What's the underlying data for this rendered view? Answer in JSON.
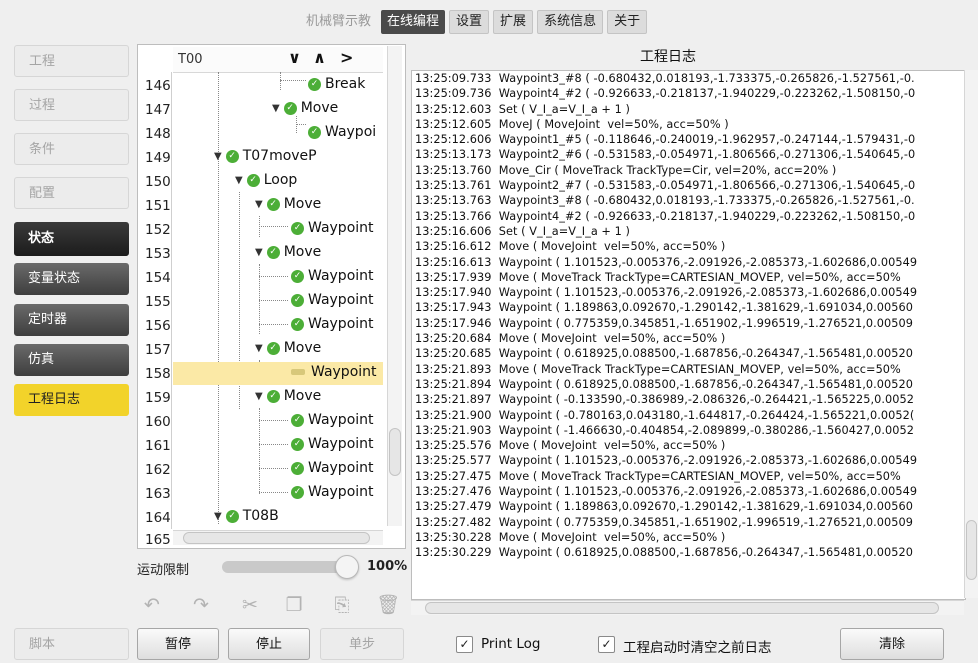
{
  "top_tabs": [
    {
      "label": "机械臂示教",
      "state": "disabled"
    },
    {
      "label": "在线编程",
      "state": "active"
    },
    {
      "label": "设置",
      "state": "normal"
    },
    {
      "label": "扩展",
      "state": "normal"
    },
    {
      "label": "系统信息",
      "state": "normal"
    },
    {
      "label": "关于",
      "state": "normal"
    }
  ],
  "sidebar": {
    "items": [
      {
        "label": "工程",
        "state": "disabled"
      },
      {
        "label": "过程",
        "state": "disabled"
      },
      {
        "label": "条件",
        "state": "disabled"
      },
      {
        "label": "配置",
        "state": "disabled"
      },
      {
        "label": "状态",
        "state": "header"
      },
      {
        "label": "变量状态",
        "state": "dark"
      },
      {
        "label": "定时器",
        "state": "dark"
      },
      {
        "label": "仿真",
        "state": "dark"
      },
      {
        "label": "工程日志",
        "state": "selected"
      }
    ],
    "script_label": "脚本"
  },
  "tree": {
    "header_label": "T00",
    "nav": {
      "down": "⌄",
      "up": "⌃",
      "right": "›"
    },
    "line_numbers": [
      "146",
      "147",
      "148",
      "149",
      "150",
      "151",
      "152",
      "153",
      "154",
      "155",
      "156",
      "157",
      "158",
      "159",
      "160",
      "161",
      "162",
      "163",
      "164",
      "165"
    ],
    "nodes": [
      {
        "label": "Break",
        "expanded": false
      },
      {
        "label": "Move",
        "expanded": true
      },
      {
        "label": "Waypoi",
        "expanded": false
      },
      {
        "label": "T07moveP",
        "expanded": true
      },
      {
        "label": "Loop",
        "expanded": true
      },
      {
        "label": "Move",
        "expanded": true
      },
      {
        "label": "Waypoint",
        "expanded": false
      },
      {
        "label": "Move",
        "expanded": true
      },
      {
        "label": "Waypoint",
        "expanded": false
      },
      {
        "label": "Waypoint",
        "expanded": false
      },
      {
        "label": "Waypoint",
        "expanded": false
      },
      {
        "label": "Move",
        "expanded": true
      },
      {
        "label": "Waypoint",
        "expanded": false,
        "selected": true
      },
      {
        "label": "Move",
        "expanded": true
      },
      {
        "label": "Waypoint",
        "expanded": false
      },
      {
        "label": "Waypoint",
        "expanded": false
      },
      {
        "label": "Waypoint",
        "expanded": false
      },
      {
        "label": "Waypoint",
        "expanded": false
      },
      {
        "label": "T08B",
        "expanded": true
      }
    ]
  },
  "speed_limit": {
    "label": "运动限制",
    "value_text": "100%",
    "value": 1.0
  },
  "toolbar_icons": [
    "undo-icon",
    "redo-icon",
    "cut-icon",
    "copy-icon",
    "paste-icon",
    "delete-icon"
  ],
  "bottom_buttons": {
    "pause": "暂停",
    "stop": "停止",
    "step": "单步"
  },
  "log": {
    "title": "工程日志",
    "lines": [
      "13:25:09.733  Waypoint3_#8 ( -0.680432,0.018193,-1.733375,-0.265826,-1.527561,-0.",
      "13:25:09.736  Waypoint4_#2 ( -0.926633,-0.218137,-1.940229,-0.223262,-1.508150,-0",
      "13:25:12.603  Set ( V_I_a=V_I_a + 1 )",
      "13:25:12.605  MoveJ ( MoveJoint  vel=50%, acc=50% )",
      "13:25:12.606  Waypoint1_#5 ( -0.118646,-0.240019,-1.962957,-0.247144,-1.579431,-0",
      "13:25:13.173  Waypoint2_#6 ( -0.531583,-0.054971,-1.806566,-0.271306,-1.540645,-0",
      "13:25:13.760  Move_Cir ( MoveTrack TrackType=Cir, vel=20%, acc=20% )",
      "13:25:13.761  Waypoint2_#7 ( -0.531583,-0.054971,-1.806566,-0.271306,-1.540645,-0",
      "13:25:13.763  Waypoint3_#8 ( -0.680432,0.018193,-1.733375,-0.265826,-1.527561,-0.",
      "13:25:13.766  Waypoint4_#2 ( -0.926633,-0.218137,-1.940229,-0.223262,-1.508150,-0",
      "13:25:16.606  Set ( V_I_a=V_I_a + 1 )",
      "13:25:16.612  Move ( MoveJoint  vel=50%, acc=50% )",
      "13:25:16.613  Waypoint ( 1.101523,-0.005376,-2.091926,-2.085373,-1.602686,0.00549",
      "13:25:17.939  Move ( MoveTrack TrackType=CARTESIAN_MOVEP, vel=50%, acc=50%",
      "13:25:17.940  Waypoint ( 1.101523,-0.005376,-2.091926,-2.085373,-1.602686,0.00549",
      "13:25:17.943  Waypoint ( 1.189863,0.092670,-1.290142,-1.381629,-1.691034,0.00560",
      "13:25:17.946  Waypoint ( 0.775359,0.345851,-1.651902,-1.996519,-1.276521,0.00509",
      "13:25:20.684  Move ( MoveJoint  vel=50%, acc=50% )",
      "13:25:20.685  Waypoint ( 0.618925,0.088500,-1.687856,-0.264347,-1.565481,0.00520",
      "13:25:21.893  Move ( MoveTrack TrackType=CARTESIAN_MOVEP, vel=50%, acc=50%",
      "13:25:21.894  Waypoint ( 0.618925,0.088500,-1.687856,-0.264347,-1.565481,0.00520",
      "13:25:21.897  Waypoint ( -0.133590,-0.386989,-2.086326,-0.264421,-1.565225,0.0052",
      "13:25:21.900  Waypoint ( -0.780163,0.043180,-1.644817,-0.264424,-1.565221,0.0052(",
      "13:25:21.903  Waypoint ( -1.466630,-0.404854,-2.089899,-0.380286,-1.560427,0.0052",
      "13:25:25.576  Move ( MoveJoint  vel=50%, acc=50% )",
      "13:25:25.577  Waypoint ( 1.101523,-0.005376,-2.091926,-2.085373,-1.602686,0.00549",
      "13:25:27.475  Move ( MoveTrack TrackType=CARTESIAN_MOVEP, vel=50%, acc=50%",
      "13:25:27.476  Waypoint ( 1.101523,-0.005376,-2.091926,-2.085373,-1.602686,0.00549",
      "13:25:27.479  Waypoint ( 1.189863,0.092670,-1.290142,-1.381629,-1.691034,0.00560",
      "13:25:27.482  Waypoint ( 0.775359,0.345851,-1.651902,-1.996519,-1.276521,0.00509",
      "13:25:30.228  Move ( MoveJoint  vel=50%, acc=50% )",
      "13:25:30.229  Waypoint ( 0.618925,0.088500,-1.687856,-0.264347,-1.565481,0.00520"
    ]
  },
  "print_log": {
    "label": "Print Log",
    "checked": true
  },
  "clear_on_start": {
    "label": "工程启动时清空之前日志",
    "checked": true
  },
  "clear_button": "清除",
  "colors": {
    "accent_yellow": "#f2d32a",
    "selected_row": "#fbe9a6",
    "check_green": "#4cae37",
    "active_tab": "#4a4a4a"
  }
}
